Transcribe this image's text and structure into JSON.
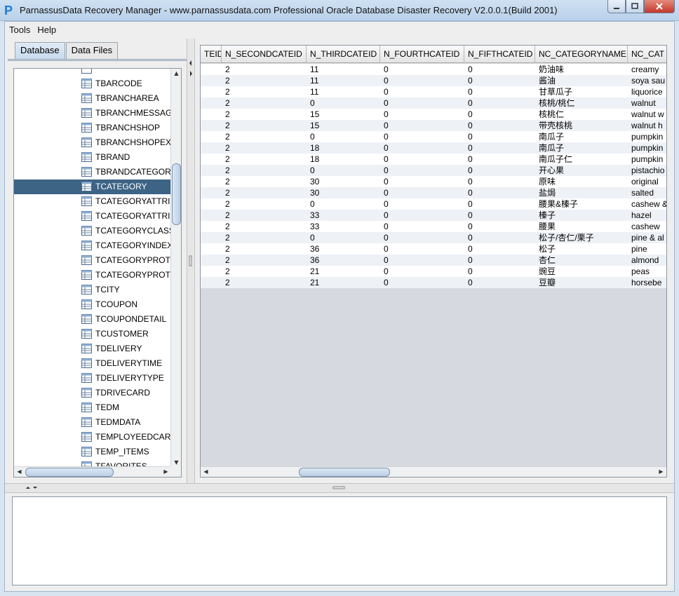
{
  "window": {
    "title": "ParnassusData Recovery Manager - www.parnassusdata.com  Professional Oracle Database Disaster Recovery   V2.0.0.1(Build 2001)",
    "icon_letter": "P",
    "buttons": [
      "minimize-icon",
      "maximize-icon",
      "close-icon"
    ]
  },
  "menu": {
    "items": [
      "Tools",
      "Help"
    ]
  },
  "tabs": [
    {
      "label": "Database",
      "active": true
    },
    {
      "label": "Data Files",
      "active": false
    }
  ],
  "tree": {
    "items": [
      "TBARCODE",
      "TBRANCHAREA",
      "TBRANCHMESSAG",
      "TBRANCHSHOP",
      "TBRANCHSHOPEX",
      "TBRAND",
      "TBRANDCATEGOR",
      "TCATEGORY",
      "TCATEGORYATTRI",
      "TCATEGORYATTRI",
      "TCATEGORYCLASS",
      "TCATEGORYINDEX",
      "TCATEGORYPROTI",
      "TCATEGORYPROTI",
      "TCITY",
      "TCOUPON",
      "TCOUPONDETAIL",
      "TCUSTOMER",
      "TDELIVERY",
      "TDELIVERYTIME",
      "TDELIVERYTYPE",
      "TDRIVECARD",
      "TEDM",
      "TEDMDATA",
      "TEMPLOYEEDCARI",
      "TEMP_ITEMS",
      "TFAVORITES"
    ],
    "selected": "TCATEGORY"
  },
  "table": {
    "columns": [
      "TEID",
      "N_SECONDCATEID",
      "N_THIRDCATEID",
      "N_FOURTHCATEID",
      "N_FIFTHCATEID",
      "NC_CATEGORYNAME",
      "NC_CAT"
    ],
    "rows": [
      [
        "",
        "2",
        "11",
        "0",
        "0",
        "奶油味",
        "creamy"
      ],
      [
        "",
        "2",
        "11",
        "0",
        "0",
        "酱油",
        "soya sau"
      ],
      [
        "",
        "2",
        "11",
        "0",
        "0",
        "甘草瓜子",
        "liquorice"
      ],
      [
        "",
        "2",
        "0",
        "0",
        "0",
        "核桃/桃仁",
        "walnut"
      ],
      [
        "",
        "2",
        "15",
        "0",
        "0",
        "核桃仁",
        "walnut w"
      ],
      [
        "",
        "2",
        "15",
        "0",
        "0",
        "带壳核桃",
        "walnut  h"
      ],
      [
        "",
        "2",
        "0",
        "0",
        "0",
        "南瓜子",
        "pumpkin"
      ],
      [
        "",
        "2",
        "18",
        "0",
        "0",
        "南瓜子",
        "pumpkin"
      ],
      [
        "",
        "2",
        "18",
        "0",
        "0",
        "南瓜子仁",
        "pumpkin"
      ],
      [
        "",
        "2",
        "0",
        "0",
        "0",
        "开心果",
        "pistachio"
      ],
      [
        "",
        "2",
        "30",
        "0",
        "0",
        "原味",
        " original"
      ],
      [
        "",
        "2",
        "30",
        "0",
        "0",
        "盐焗",
        "salted"
      ],
      [
        "",
        "2",
        "0",
        "0",
        "0",
        "腰果&榛子",
        "cashew &"
      ],
      [
        "",
        "2",
        "33",
        "0",
        "0",
        "榛子",
        " hazel"
      ],
      [
        "",
        "2",
        "33",
        "0",
        "0",
        "腰果",
        " cashew"
      ],
      [
        "",
        "2",
        "0",
        "0",
        "0",
        "松子/杏仁/栗子",
        "pine & al"
      ],
      [
        "",
        "2",
        "36",
        "0",
        "0",
        "松子",
        " pine"
      ],
      [
        "",
        "2",
        "36",
        "0",
        "0",
        "杏仁",
        " almond"
      ],
      [
        "",
        "2",
        "21",
        "0",
        "0",
        "豌豆",
        " peas"
      ],
      [
        "",
        "2",
        "21",
        "0",
        "0",
        "豆瓣",
        " horsebe"
      ]
    ]
  },
  "log": {
    "text": ""
  }
}
